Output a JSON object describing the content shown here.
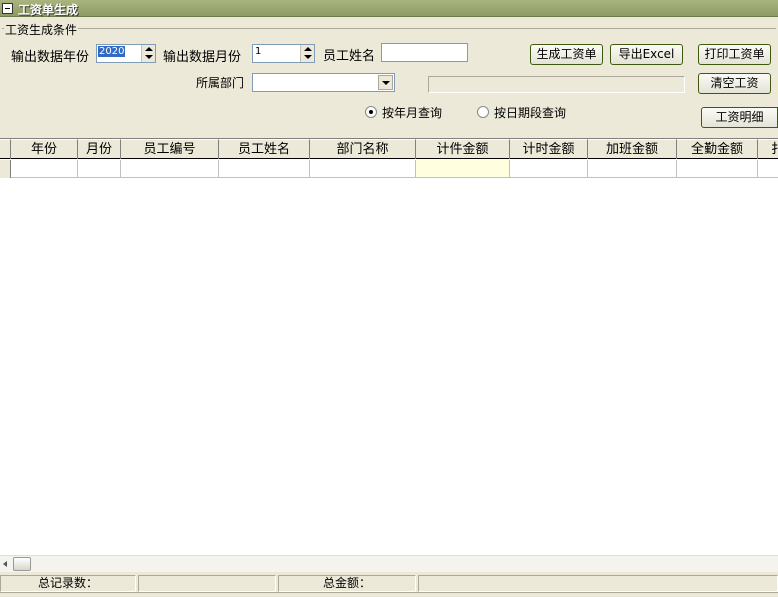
{
  "window": {
    "title": "工资单生成"
  },
  "conditions": {
    "group_title": "工资生成条件",
    "year_label": "输出数据年份",
    "year_value": "2020",
    "month_label": "输出数据月份",
    "month_value": "1",
    "employee_name_label": "员工姓名",
    "employee_name_value": "",
    "department_label": "所属部门",
    "department_value": "",
    "radio_year_month": "按年月查询",
    "radio_date_range": "按日期段查询",
    "selected_mode": "year_month"
  },
  "buttons": {
    "generate": "生成工资单",
    "export_excel": "导出Excel",
    "print": "打印工资单",
    "clear": "清空工资",
    "detail": "工资明细"
  },
  "grid": {
    "columns": [
      "年份",
      "月份",
      "员工编号",
      "员工姓名",
      "部门名称",
      "计件金额",
      "计时金额",
      "加班金额",
      "全勤金额",
      "扌"
    ]
  },
  "status": {
    "total_records_label": "总记录数：",
    "total_records_value": "",
    "total_amount_label": "总金额：",
    "total_amount_value": ""
  },
  "colors": {
    "titlebar": "#a9b57f",
    "highlight_column": "#ffffe0",
    "selection": "#316ac5"
  }
}
